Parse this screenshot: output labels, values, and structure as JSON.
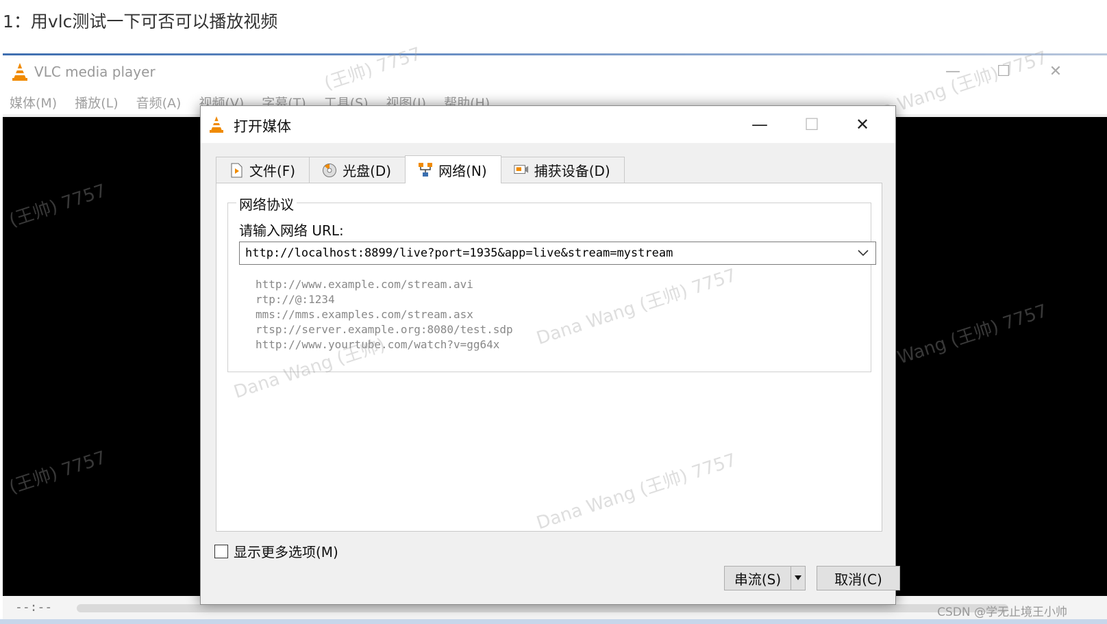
{
  "heading": "1：用vlc测试一下可否可以播放视频",
  "vlc": {
    "title": "VLC media player",
    "menu": [
      "媒体(M)",
      "播放(L)",
      "音频(A)",
      "视频(V)",
      "字幕(T)",
      "工具(S)",
      "视图(I)",
      "帮助(H)"
    ],
    "time": "--:--"
  },
  "dialog": {
    "title": "打开媒体",
    "tabs": [
      {
        "label": "文件(F)",
        "icon": "file-icon"
      },
      {
        "label": "光盘(D)",
        "icon": "disc-icon"
      },
      {
        "label": "网络(N)",
        "icon": "network-icon"
      },
      {
        "label": "捕获设备(D)",
        "icon": "capture-device-icon"
      }
    ],
    "active_tab": 2,
    "group_title": "网络协议",
    "url_label": "请输入网络 URL:",
    "url_value": "http://localhost:8899/live?port=1935&app=live&stream=mystream",
    "examples": [
      "http://www.example.com/stream.avi",
      "rtp://@:1234",
      "mms://mms.examples.com/stream.asx",
      "rtsp://server.example.org:8080/test.sdp",
      "http://www.yourtube.com/watch?v=gg64x"
    ],
    "show_more_options": "显示更多选项(M)",
    "stream_button": "串流(S)",
    "cancel_button": "取消(C)"
  },
  "watermarks": {
    "text_name": "Dana Wang",
    "text_cn": "(王帅)",
    "text_num": "7757",
    "csdn": "CSDN @学无止境王小帅"
  },
  "colors": {
    "vlc_orange": "#f08a00",
    "video_bg": "#000000",
    "dialog_bg": "#f0f0f0"
  }
}
